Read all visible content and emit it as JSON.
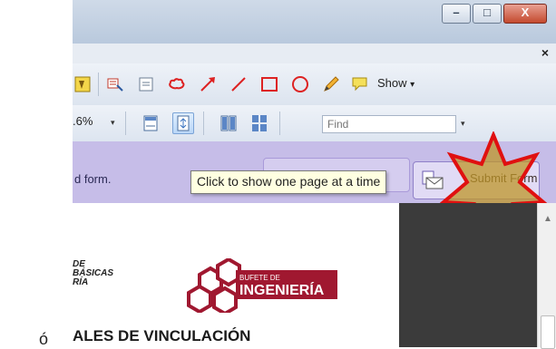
{
  "window": {
    "minimize_glyph": "–",
    "maximize_glyph": "□",
    "close_glyph": "X"
  },
  "menubar": {
    "close_glyph": "×"
  },
  "toolbar1": {
    "icons": [
      "sticky-note-icon",
      "text-edit-icon",
      "text-box-icon",
      "cloud-icon",
      "arrow-icon",
      "line-icon",
      "rectangle-icon",
      "oval-icon",
      "pencil-icon",
      "comment-bubble-icon"
    ],
    "show_label": "Show",
    "show_arrow": "▾"
  },
  "toolbar2": {
    "zoom_value": ".6%",
    "zoom_arrow": "▾",
    "find_placeholder": "Find",
    "find_arrow": "▾"
  },
  "formbar": {
    "message_fragment": "d form.",
    "submit_label": "Submit Form"
  },
  "tooltip": {
    "text": "Click to show one page at a time"
  },
  "document": {
    "university_lines": [
      "DE",
      "BÁSICAS",
      "RÍA"
    ],
    "logo_top": "BUFETE DE",
    "logo_main": "INGENIERÍA",
    "heading_fragment": "ALES DE VINCULACIÓN",
    "stray_char": "ó"
  },
  "colors": {
    "form_bar": "#c6bde8",
    "tooltip_bg": "#ffffe1",
    "highlight_star": "#e01010",
    "logo_red": "#a01830"
  }
}
